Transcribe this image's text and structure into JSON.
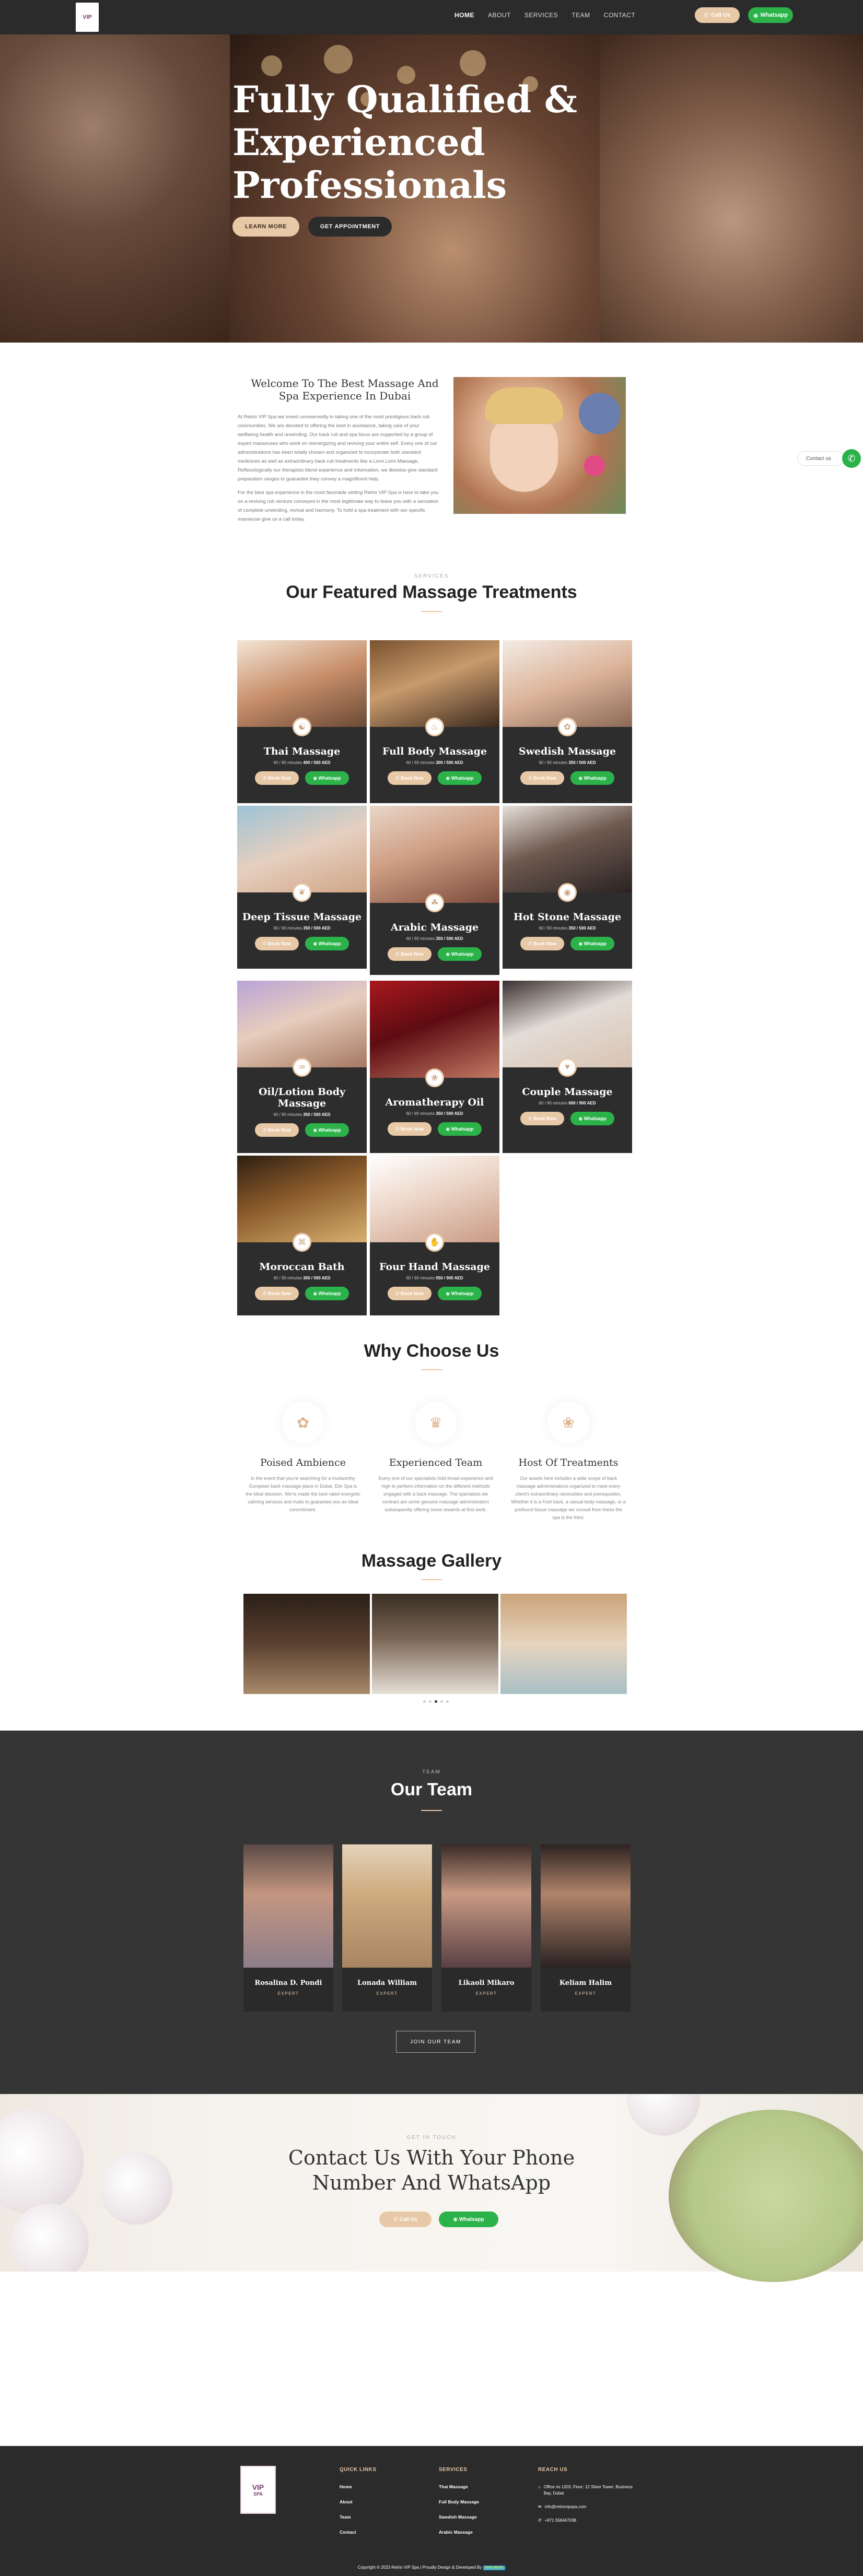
{
  "header": {
    "logo_text": "VIP",
    "nav": [
      "HOME",
      "ABOUT",
      "SERVICES",
      "TEAM",
      "CONTACT"
    ],
    "call_label": "Call Us",
    "whatsapp_label": "Whatsapp"
  },
  "hero": {
    "title_line1": "Fully Qualified &",
    "title_line2": "Experienced",
    "title_line3": "Professionals",
    "learn_more": "LEARN MORE",
    "get_appointment": "GET APPOINTMENT"
  },
  "welcome": {
    "title": "Welcome To The Best Massage And Spa Experience In Dubai",
    "para1": "At Retrio VIP Spa we invest unreservedly in taking one of the most prestigious back rub communities. We are devoted to offering the best in assistance, taking care of your wellbeing health and unwinding. Our back rub and spa focus are supported by a group of expert masseuses who work on reenergizing and reviving your entire self. Every one of our administrations has been totally chosen and organized to incorporate both standard medicines as well as extraordinary back rub treatments like a Lomi Lomi Massage, Reflexologically our therapists blend experience and information, we likewise give standard preparation ranges to guarantee they convey a magnificent help.",
    "para2": "For the best spa experience in the most favorable setting Retrio VIP Spa is here to take you on a reviving rub venture conveyed in the most legitimate way to leave you with a sensation of complete unwinding, revival and harmony. To hold a spa treatment with our specific masseuse give us a call today."
  },
  "floating": {
    "contact_label": "Contact us"
  },
  "services": {
    "kicker": "SERVICES",
    "title": "Our Featured Massage Treatments",
    "book_label": "Book Now",
    "wa_label": "Whatsapp",
    "items": [
      {
        "title": "Thai Massage",
        "meta_pre": "60 / 90 minutes",
        "price": "400 / 500 AED"
      },
      {
        "title": "Full Body Massage",
        "meta_pre": "60 / 90 minutes",
        "price": "300 / 500 AED"
      },
      {
        "title": "Swedish Massage",
        "meta_pre": "60 / 90 minutes",
        "price": "350 / 500 AED"
      },
      {
        "title": "Deep Tissue Massage",
        "meta_pre": "60 / 90 minutes",
        "price": "350 / 500 AED"
      },
      {
        "title": "Arabic Massage",
        "meta_pre": "60 / 90 minutes",
        "price": "350 / 500 AED"
      },
      {
        "title": "Hot Stone Massage",
        "meta_pre": "60 / 90 minutes",
        "price": "350 / 500 AED"
      },
      {
        "title": "Oil/Lotion Body Massage",
        "meta_pre": "60 / 90 minutes",
        "price": "350 / 500 AED"
      },
      {
        "title": "Aromatherapy Oil",
        "meta_pre": "60 / 90 minutes",
        "price": "350 / 500 AED"
      },
      {
        "title": "Couple Massage",
        "meta_pre": "60 / 90 minutes",
        "price": "600 / 900 AED"
      },
      {
        "title": "Moroccan Bath",
        "meta_pre": "60 / 90 minutes",
        "price": "300 / 500 AED"
      },
      {
        "title": "Four Hand Massage",
        "meta_pre": "60 / 90 minutes",
        "price": "550 / 900 AED"
      }
    ]
  },
  "why": {
    "title": "Why Choose Us",
    "items": [
      {
        "title": "Poised Ambience",
        "text": "In the event that you're searching for a trustworthy European back massage place in Dubai, Elio Spa is the ideal decision. We're made the best rated energetic calming services and rivals to guarantee you an ideal commitment."
      },
      {
        "title": "Experienced Team",
        "text": "Every one of our specialists hold broad experience and high to perform information on the different methods engaged with a back massage. The specialists we contract are some genuine massage administrators subsequently offering some rewards at first work."
      },
      {
        "title": "Host Of Treatments",
        "text": "Our assets here includes a wide scope of back massage administrations organized to meet every client's extraordinary necessities and prerequisites. Whether it is a Foot back, a casual body massage, or a profound tissue massage we consult from these the spa is the third."
      }
    ]
  },
  "gallery": {
    "title": "Massage Gallery"
  },
  "team": {
    "kicker": "TEAM",
    "title": "Our Team",
    "join_label": "JOIN OUR TEAM",
    "members": [
      {
        "name": "Rosalina D. Pondi",
        "role": "EXPERT"
      },
      {
        "name": "Lonada William",
        "role": "EXPERT"
      },
      {
        "name": "Likaoli Mikaro",
        "role": "EXPERT"
      },
      {
        "name": "Keliam Halim",
        "role": "EXPERT"
      }
    ]
  },
  "contact": {
    "kicker": "GET IN TOUCH",
    "title_line1": "Contact Us With Your Phone",
    "title_line2": "Number And WhatsApp",
    "call_label": "Call Us",
    "wa_label": "Whatsapp"
  },
  "footer": {
    "logo_line1": "VIP",
    "logo_line2": "SPA",
    "quick_title": "QUICK LINKS",
    "quick_links": [
      "Home",
      "About",
      "Team",
      "Contact"
    ],
    "services_title": "SERVICES",
    "service_links": [
      "Thai Massage",
      "Full Body Massage",
      "Swedish Massage",
      "Arabic Massage"
    ],
    "reach_title": "REACH US",
    "address": "Office no 1203, Floor: 12 Silver Tower, Business Bay, Dubai",
    "email": "info@retriovipspa.com",
    "phone": "+971 556447038",
    "copyright": "Copyright © 2023 Retrio VIP Spa | Proudly Design & Developed By",
    "badge": "Web Worth"
  },
  "colors": {
    "accent": "#e8c9a7",
    "whatsapp": "#2bb34a",
    "dark": "#2b2b2b"
  }
}
